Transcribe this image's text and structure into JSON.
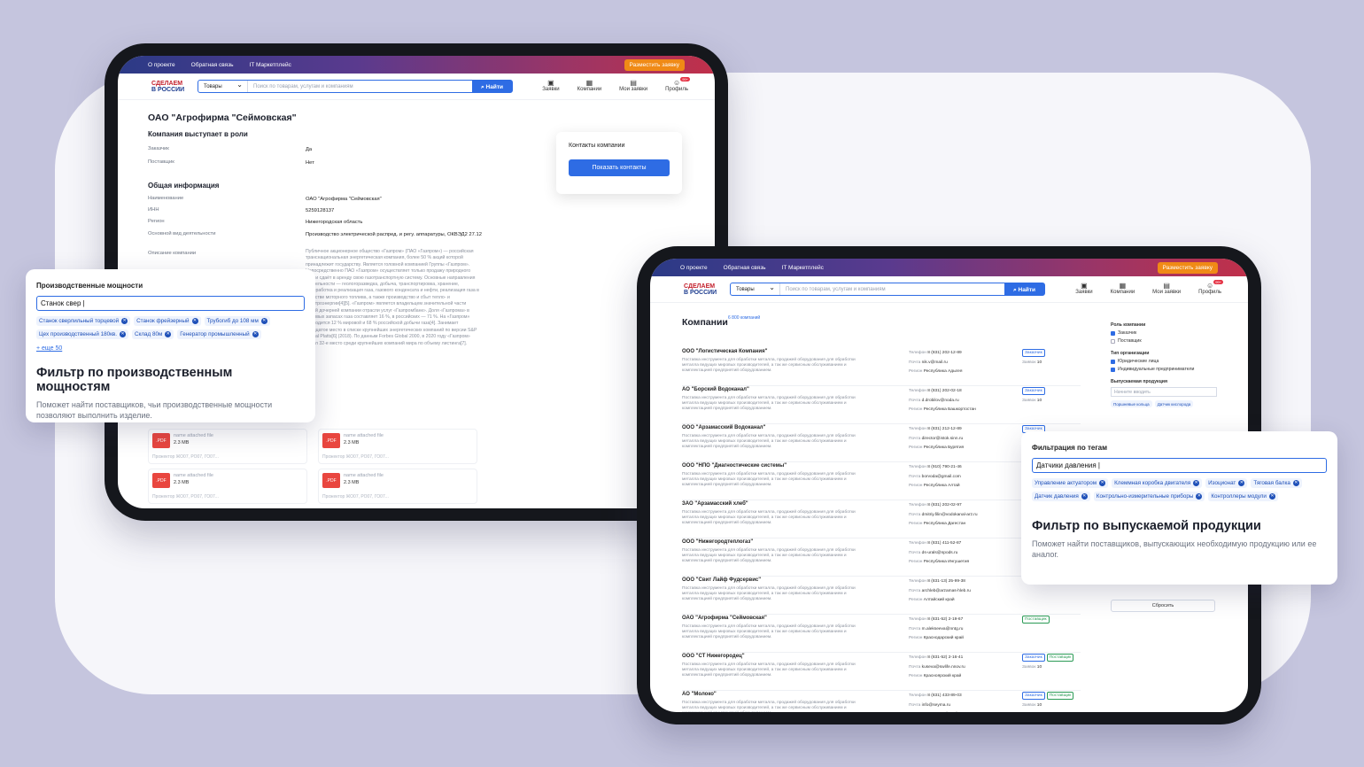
{
  "top_links": [
    "О проекте",
    "Обратная связь",
    "IT Маркетплейс"
  ],
  "cta": "Разместить заявку",
  "logo": {
    "line1": "СДЕЛАЕМ",
    "line2": "В РОССИИ"
  },
  "search": {
    "category": "Товары",
    "placeholder": "Поиск по товарам, услугам и компаниям",
    "button": "Найти"
  },
  "nav": {
    "orders": "Заявки",
    "companies": "Компании",
    "my_orders": "Мои заявки",
    "profile": "Профиль",
    "badge": "99+"
  },
  "company": {
    "title": "ОАО \"Агрофирма \"Сеймовская\"",
    "roles_heading": "Компания выступает в роли",
    "customer_label": "Заказчик",
    "customer_value": "Да",
    "supplier_label": "Поставщик",
    "supplier_value": "Нет",
    "general_heading": "Общая информация",
    "name_label": "Наименование",
    "name_value": "ОАО \"Агрофирма \"Сеймовская\"",
    "inn_label": "ИНН",
    "inn_value": "5259128137",
    "region_label": "Регион",
    "region_value": "Нижегородская область",
    "activity_label": "Основной вид деятельности",
    "activity_value": "Производство электрической распред. и регу. аппаратуры, ОКВЭД2 27.12",
    "desc_label": "Описание компании",
    "desc_value": "Публичное акционерное общество «Газпром» (ПАО «Газпром») — российская транснациональная энергетическая компания, более 50 % акций которой принадлежит государству. Является головной компанией Группы «Газпром». Непосредственно ПАО «Газпром» осуществляет только продажу природного газа и сдаёт в аренду свою газотранспортную систему. Основные направления деятельности — геологоразведка, добыча, транспортировка, хранение, переработка и реализация газа, газового конденсата и нефти, реализация газа в качестве моторного топлива, а также производство и сбыт тепло- и электроэнергии[4][5]. «Газпром» является владельцем значительной части акций дочерней компании отрасли услуг «Газпромбанк». Доля «Газпрома» в мировых запасах газа составляет 16 %, в российских — 71 %. На «Газпром» приходится 12 % мировой и 68 % российской добычи газа[4]. Занимает двадцатое место в списке крупнейших энергетических компаний по версии S&P Global Platts[6] (2018). По данным Forbes Global 2000, в 2020 году «Газпром» занял 32-е место среди крупнейших компаний мира по объему листинга[7].",
    "contacts_title": "Контакты компании",
    "contacts_button": "Показать контакты",
    "files": [
      {
        "name": "name attached file",
        "size": "2.3 MB",
        "preview": "Прожектор ЖО07, РО07, ГО07..."
      },
      {
        "name": "name attached file",
        "size": "2.3 MB",
        "preview": "Прожектор ЖО07, РО07, ГО07..."
      },
      {
        "name": "name attached file",
        "size": "2.3 MB",
        "preview": "Прожектор ЖО07, РО07, ГО07..."
      },
      {
        "name": "name attached file",
        "size": "2.3 MB",
        "preview": "Прожектор ЖО07, РО07, ГО07..."
      }
    ],
    "pdf_label": ".PDF"
  },
  "popup1": {
    "heading": "Производственные мощности",
    "input_value": "Станок свер |",
    "chips": [
      "Станок сверлильный торцевой",
      "Станок фрейзерный",
      "Трубогиб до 108 мм",
      "Цех производственный 180кв.",
      "Склад 80м",
      "Генератор промышленный"
    ],
    "more": "+ еще 50",
    "title": "Фильтр по производственным мощностям",
    "subtitle": "Поможет найти поставщиков, чьи производственные мощности позволяют выполнить изделие."
  },
  "popup2": {
    "heading": "Фильтрация по тегам",
    "input_value": "Датчики давления |",
    "chips": [
      "Управление актуатором",
      "Клеммная коробка двигателя",
      "Изоционат",
      "Тяговая балка",
      "Датчик давления",
      "Контрольно-измерительные приборы",
      "Контроллеры модули"
    ],
    "title": "Фильтр по выпускаемой продукции",
    "subtitle": "Поможет найти поставщиков, выпускающих необходимую продукцию или ее аналог."
  },
  "list": {
    "title": "Компании",
    "count": "6 800 компаний",
    "desc": "Поставка инструмента для обработки металла, продажей оборудования для обработки металла ведущих мировых производителей, а так же сервисным обслуживанием и комплектацией предприятий оборудованием.",
    "phone_label": "Телефон",
    "mail_label": "Почта",
    "region_label": "Регион",
    "orders_label": "Заявок",
    "tag_customer": "Заказчик",
    "tag_supplier": "Поставщик",
    "rows": [
      {
        "name": "ООО \"Логистическая Компания\"",
        "phone": "8 (831) 202-12-89",
        "mail": "nik.v@mail.ru",
        "region": "Республика Адыгея",
        "tags": [
          "customer"
        ],
        "orders": "10"
      },
      {
        "name": "АО \"Борский Водоканал\"",
        "phone": "8 (831) 202-02-18",
        "mail": "d.drobilov@noda.ru",
        "region": "Республика Башкортостан",
        "tags": [
          "customer"
        ],
        "orders": "10"
      },
      {
        "name": "ООО \"Арзамасский Водоканал\"",
        "phone": "8 (831) 212-12-89",
        "mail": "director@istok.sinn.ru",
        "region": "Республика Бурятия",
        "tags": [
          "customer"
        ],
        "orders": "10"
      },
      {
        "name": "ООО \"НПО \"Диагностические системы\"",
        "phone": "8 (910) 790-21-46",
        "mail": "borvoda@gmail.com",
        "region": "Республика Алтай",
        "tags": [],
        "orders": ""
      },
      {
        "name": "ЗАО \"Арзамасский хлеб\"",
        "phone": "8 (831) 202-02-97",
        "mail": "dmitriy.filin@vodokanal-arz.ru",
        "region": "Республика Дагестан",
        "tags": [],
        "orders": ""
      },
      {
        "name": "ООО \"Нижегородтеплогаз\"",
        "phone": "8 (831) 411-52-87",
        "mail": "ds-urals@npods.ru",
        "region": "Республика Ингушетия",
        "tags": [],
        "orders": ""
      },
      {
        "name": "ООО \"Свит Лайф Фудсервис\"",
        "phone": "8 (831-13) 25-99-38",
        "mail": "archleb@arzamas-hleb.ru",
        "region": "Алтайский край",
        "tags": [],
        "orders": ""
      },
      {
        "name": "ОАО \"Агрофирма \"Сеймовская\"",
        "phone": "8 (831-52) 2-19-67",
        "mail": "m.alekseeva@nntg.ru",
        "region": "Краснодарский край",
        "tags": [
          "supplier"
        ],
        "orders": ""
      },
      {
        "name": "ООО \"СТ Нижегородец\"",
        "phone": "8 (831-52) 2-16-41",
        "mail": "kuseva@swlife.nnov.ru",
        "region": "Красноярский край",
        "tags": [
          "customer",
          "supplier"
        ],
        "orders": "10"
      },
      {
        "name": "АО \"Молоко\"",
        "phone": "8 (831) 433-89-03",
        "mail": "info@seyma.ru",
        "region": "Приморский край",
        "tags": [
          "customer",
          "supplier"
        ],
        "orders": "10"
      }
    ]
  },
  "sidebar": {
    "role_heading": "Роль компании",
    "role_customer": "Заказчик",
    "role_supplier": "Поставщик",
    "type_heading": "Тип организации",
    "type_legal": "Юридические лица",
    "type_ip": "Индивидуальные предприниматели",
    "product_heading": "Выпускаемая продукция",
    "product_placeholder": "Начните вводить",
    "product_chips": [
      "Поршневые кольца",
      "Датчик кислорода"
    ],
    "reset": "Сбросить"
  }
}
